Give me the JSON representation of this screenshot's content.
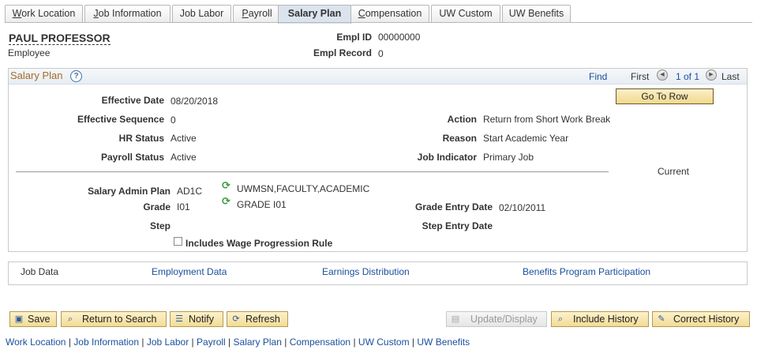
{
  "tabs": [
    {
      "label": "Work Location",
      "ul": "W",
      "rest": "ork Location"
    },
    {
      "label": "Job Information",
      "ul": "J",
      "rest": "ob Information"
    },
    {
      "label": "Job Labor",
      "ul": "",
      "rest": "Job Labor"
    },
    {
      "label": "Payroll",
      "ul": "P",
      "rest": "ayroll"
    },
    {
      "label": "Salary Plan",
      "ul": "",
      "rest": "Salary Plan"
    },
    {
      "label": "Compensation",
      "ul": "C",
      "rest": "ompensation"
    },
    {
      "label": "UW Custom",
      "ul": "",
      "rest": "UW Custom"
    },
    {
      "label": "UW Benefits",
      "ul": "",
      "rest": "UW Benefits"
    }
  ],
  "employee": {
    "name": "PAUL PROFESSOR",
    "role": "Employee",
    "empl_id_label": "Empl ID",
    "empl_id": "00000000",
    "empl_record_label": "Empl Record",
    "empl_record": "0"
  },
  "salary_plan": {
    "title": "Salary Plan",
    "help_glyph": "?",
    "find": "Find",
    "first": "First",
    "count": "1 of 1",
    "last": "Last",
    "go_to_row": "Go To Row",
    "fields": {
      "effective_date": {
        "label": "Effective Date",
        "value": "08/20/2018"
      },
      "effective_sequence": {
        "label": "Effective Sequence",
        "value": "0"
      },
      "hr_status": {
        "label": "HR Status",
        "value": "Active"
      },
      "payroll_status": {
        "label": "Payroll Status",
        "value": "Active"
      },
      "action": {
        "label": "Action",
        "value": "Return from Short Work Break"
      },
      "reason": {
        "label": "Reason",
        "value": "Start Academic Year"
      },
      "job_indicator": {
        "label": "Job Indicator",
        "value": "Primary Job"
      },
      "current": "Current",
      "salary_admin_plan": {
        "label": "Salary Admin Plan",
        "value": "AD1C",
        "description": "UWMSN,FACULTY,ACADEMIC"
      },
      "grade": {
        "label": "Grade",
        "value": "I01",
        "description": "GRADE I01"
      },
      "grade_entry_date": {
        "label": "Grade Entry Date",
        "value": "02/10/2011"
      },
      "step": {
        "label": "Step",
        "value": ""
      },
      "step_entry_date": {
        "label": "Step Entry Date",
        "value": ""
      },
      "wage_progression": {
        "label": "Includes Wage Progression Rule",
        "checked": false
      }
    }
  },
  "related_links": {
    "job_data": "Job Data",
    "employment_data": "Employment Data",
    "earnings_distribution": "Earnings Distribution",
    "benefits_program": "Benefits Program Participation"
  },
  "buttons": {
    "save": "Save",
    "return_to_search": "Return to Search",
    "notify": "Notify",
    "refresh": "Refresh",
    "update_display": "Update/Display",
    "include_history": "Include History",
    "correct_history": "Correct History"
  },
  "footer_links": [
    "Work Location",
    "Job Information",
    "Job Labor",
    "Payroll",
    "Salary Plan",
    "Compensation",
    "UW Custom",
    "UW Benefits"
  ],
  "footer_separator": "|"
}
